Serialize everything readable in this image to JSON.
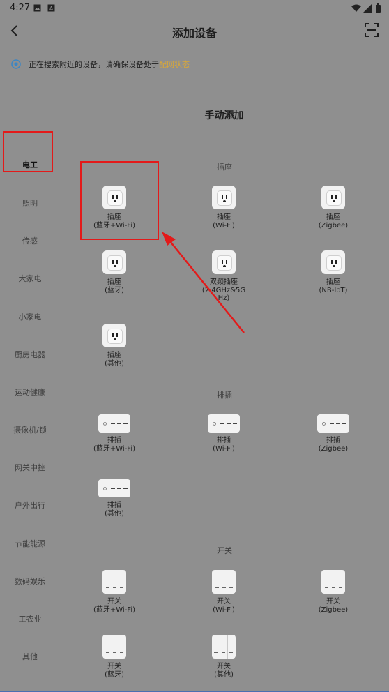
{
  "status": {
    "time": "4:27",
    "left_icons": [
      "image-icon",
      "font-a-icon"
    ],
    "right_icons": [
      "wifi-icon",
      "signal-icon",
      "battery-icon"
    ]
  },
  "header": {
    "title": "添加设备"
  },
  "notice": {
    "text": "正在搜索附近的设备，请确保设备处于",
    "link": "配网状态"
  },
  "section": {
    "title": "手动添加"
  },
  "categories": [
    "电工",
    "照明",
    "传感",
    "大家电",
    "小家电",
    "厨房电器",
    "运动健康",
    "摄像机/锁",
    "网关中控",
    "户外出行",
    "节能能源",
    "数码娱乐",
    "工农业",
    "其他"
  ],
  "groups": {
    "socket": {
      "label": "插座",
      "items": [
        {
          "name": "插座",
          "sub": "(蓝牙+Wi-Fi)"
        },
        {
          "name": "插座",
          "sub": "(Wi-Fi)"
        },
        {
          "name": "插座",
          "sub": "(Zigbee)"
        },
        {
          "name": "插座",
          "sub": "(蓝牙)"
        },
        {
          "name": "双频插座",
          "sub": "(2.4GHz&5G\nHz)"
        },
        {
          "name": "插座",
          "sub": "(NB-IoT)"
        },
        {
          "name": "插座",
          "sub": "(其他)"
        }
      ]
    },
    "strip": {
      "label": "排插",
      "items": [
        {
          "name": "排插",
          "sub": "(蓝牙+Wi-Fi)"
        },
        {
          "name": "排插",
          "sub": "(Wi-Fi)"
        },
        {
          "name": "排插",
          "sub": "(Zigbee)"
        },
        {
          "name": "排插",
          "sub": "(其他)"
        }
      ]
    },
    "switch": {
      "label": "开关",
      "items": [
        {
          "name": "开关",
          "sub": "(蓝牙+Wi-Fi)"
        },
        {
          "name": "开关",
          "sub": "(Wi-Fi)"
        },
        {
          "name": "开关",
          "sub": "(Zigbee)"
        },
        {
          "name": "开关",
          "sub": "(蓝牙)"
        },
        {
          "name": "开关",
          "sub": "(其他)"
        }
      ]
    }
  },
  "colors": {
    "overlay_bg": "#8f8f8f",
    "highlight": "#e31a1a",
    "link": "#d9a838"
  }
}
